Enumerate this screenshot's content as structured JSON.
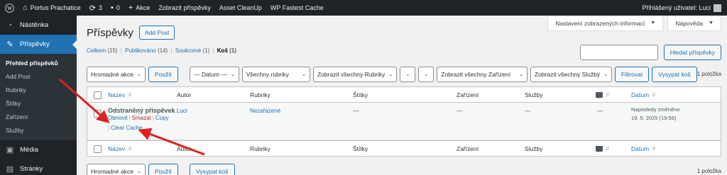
{
  "adminbar": {
    "site_name": "Portus Prachatice",
    "updates_count": "3",
    "comments_count": "0",
    "new_label": "Akce",
    "view_posts": "Zobrazit příspěvky",
    "asset_cleanup": "Asset CleanUp",
    "wp_fastest_cache": "WP Fastest Cache",
    "greeting": "Přihlášený uživatel: Luci"
  },
  "sidebar": {
    "dashboard": "Nástěnka",
    "posts": "Příspěvky",
    "submenu": [
      "Přehled příspěvků",
      "Add Post",
      "Rubriky",
      "Štítky",
      "Zařízení",
      "Služby"
    ],
    "media": "Média",
    "pages": "Stránky"
  },
  "screen_options": "Nastavení zobrazených informací",
  "help": "Nápověda",
  "page_title": "Příspěvky",
  "add_post_button": "Add Post",
  "views": [
    {
      "label": "Celkem",
      "count": "(15)"
    },
    {
      "label": "Publikováno",
      "count": "(14)"
    },
    {
      "label": "Soukromé",
      "count": "(1)"
    },
    {
      "label": "Koš",
      "count": "(1)"
    }
  ],
  "search_button": "Hledat příspěvky",
  "filters": {
    "bulk_actions": "Hromadné akce",
    "apply": "Použít",
    "dates": "— Datum —",
    "categories": "Všechny rubriky",
    "all_categories_custom": "Zobrazit všechny Rubriky",
    "all_devices": "Zobrazit všechny Zařízení",
    "all_services": "Zobrazit všechny Služby",
    "filter": "Filtrovat",
    "empty_trash": "Vysypat koš",
    "items": "1 položka"
  },
  "columns": {
    "title": "Název",
    "author": "Autor",
    "categories": "Rubriky",
    "tags": "Štítky",
    "devices": "Zařízení",
    "services": "Služby",
    "date": "Datum"
  },
  "post": {
    "title": "Odstraněný příspěvek",
    "author": "Luci",
    "category": "Nezařazené",
    "tags": "—",
    "devices": "—",
    "services": "—",
    "comments": "—",
    "date_status": "Naposledy změněno",
    "date_value": "19. 5. 2025 (19:58)",
    "actions": {
      "restore": "Obnovit",
      "delete": "Smazat",
      "copy": "Copy",
      "clear_cache": "Clear Cache"
    }
  },
  "colors": {
    "adminbar_bg": "#1d2327",
    "accent": "#2271b1",
    "danger": "#b32d2e",
    "annotation_arrow": "#e02020"
  }
}
